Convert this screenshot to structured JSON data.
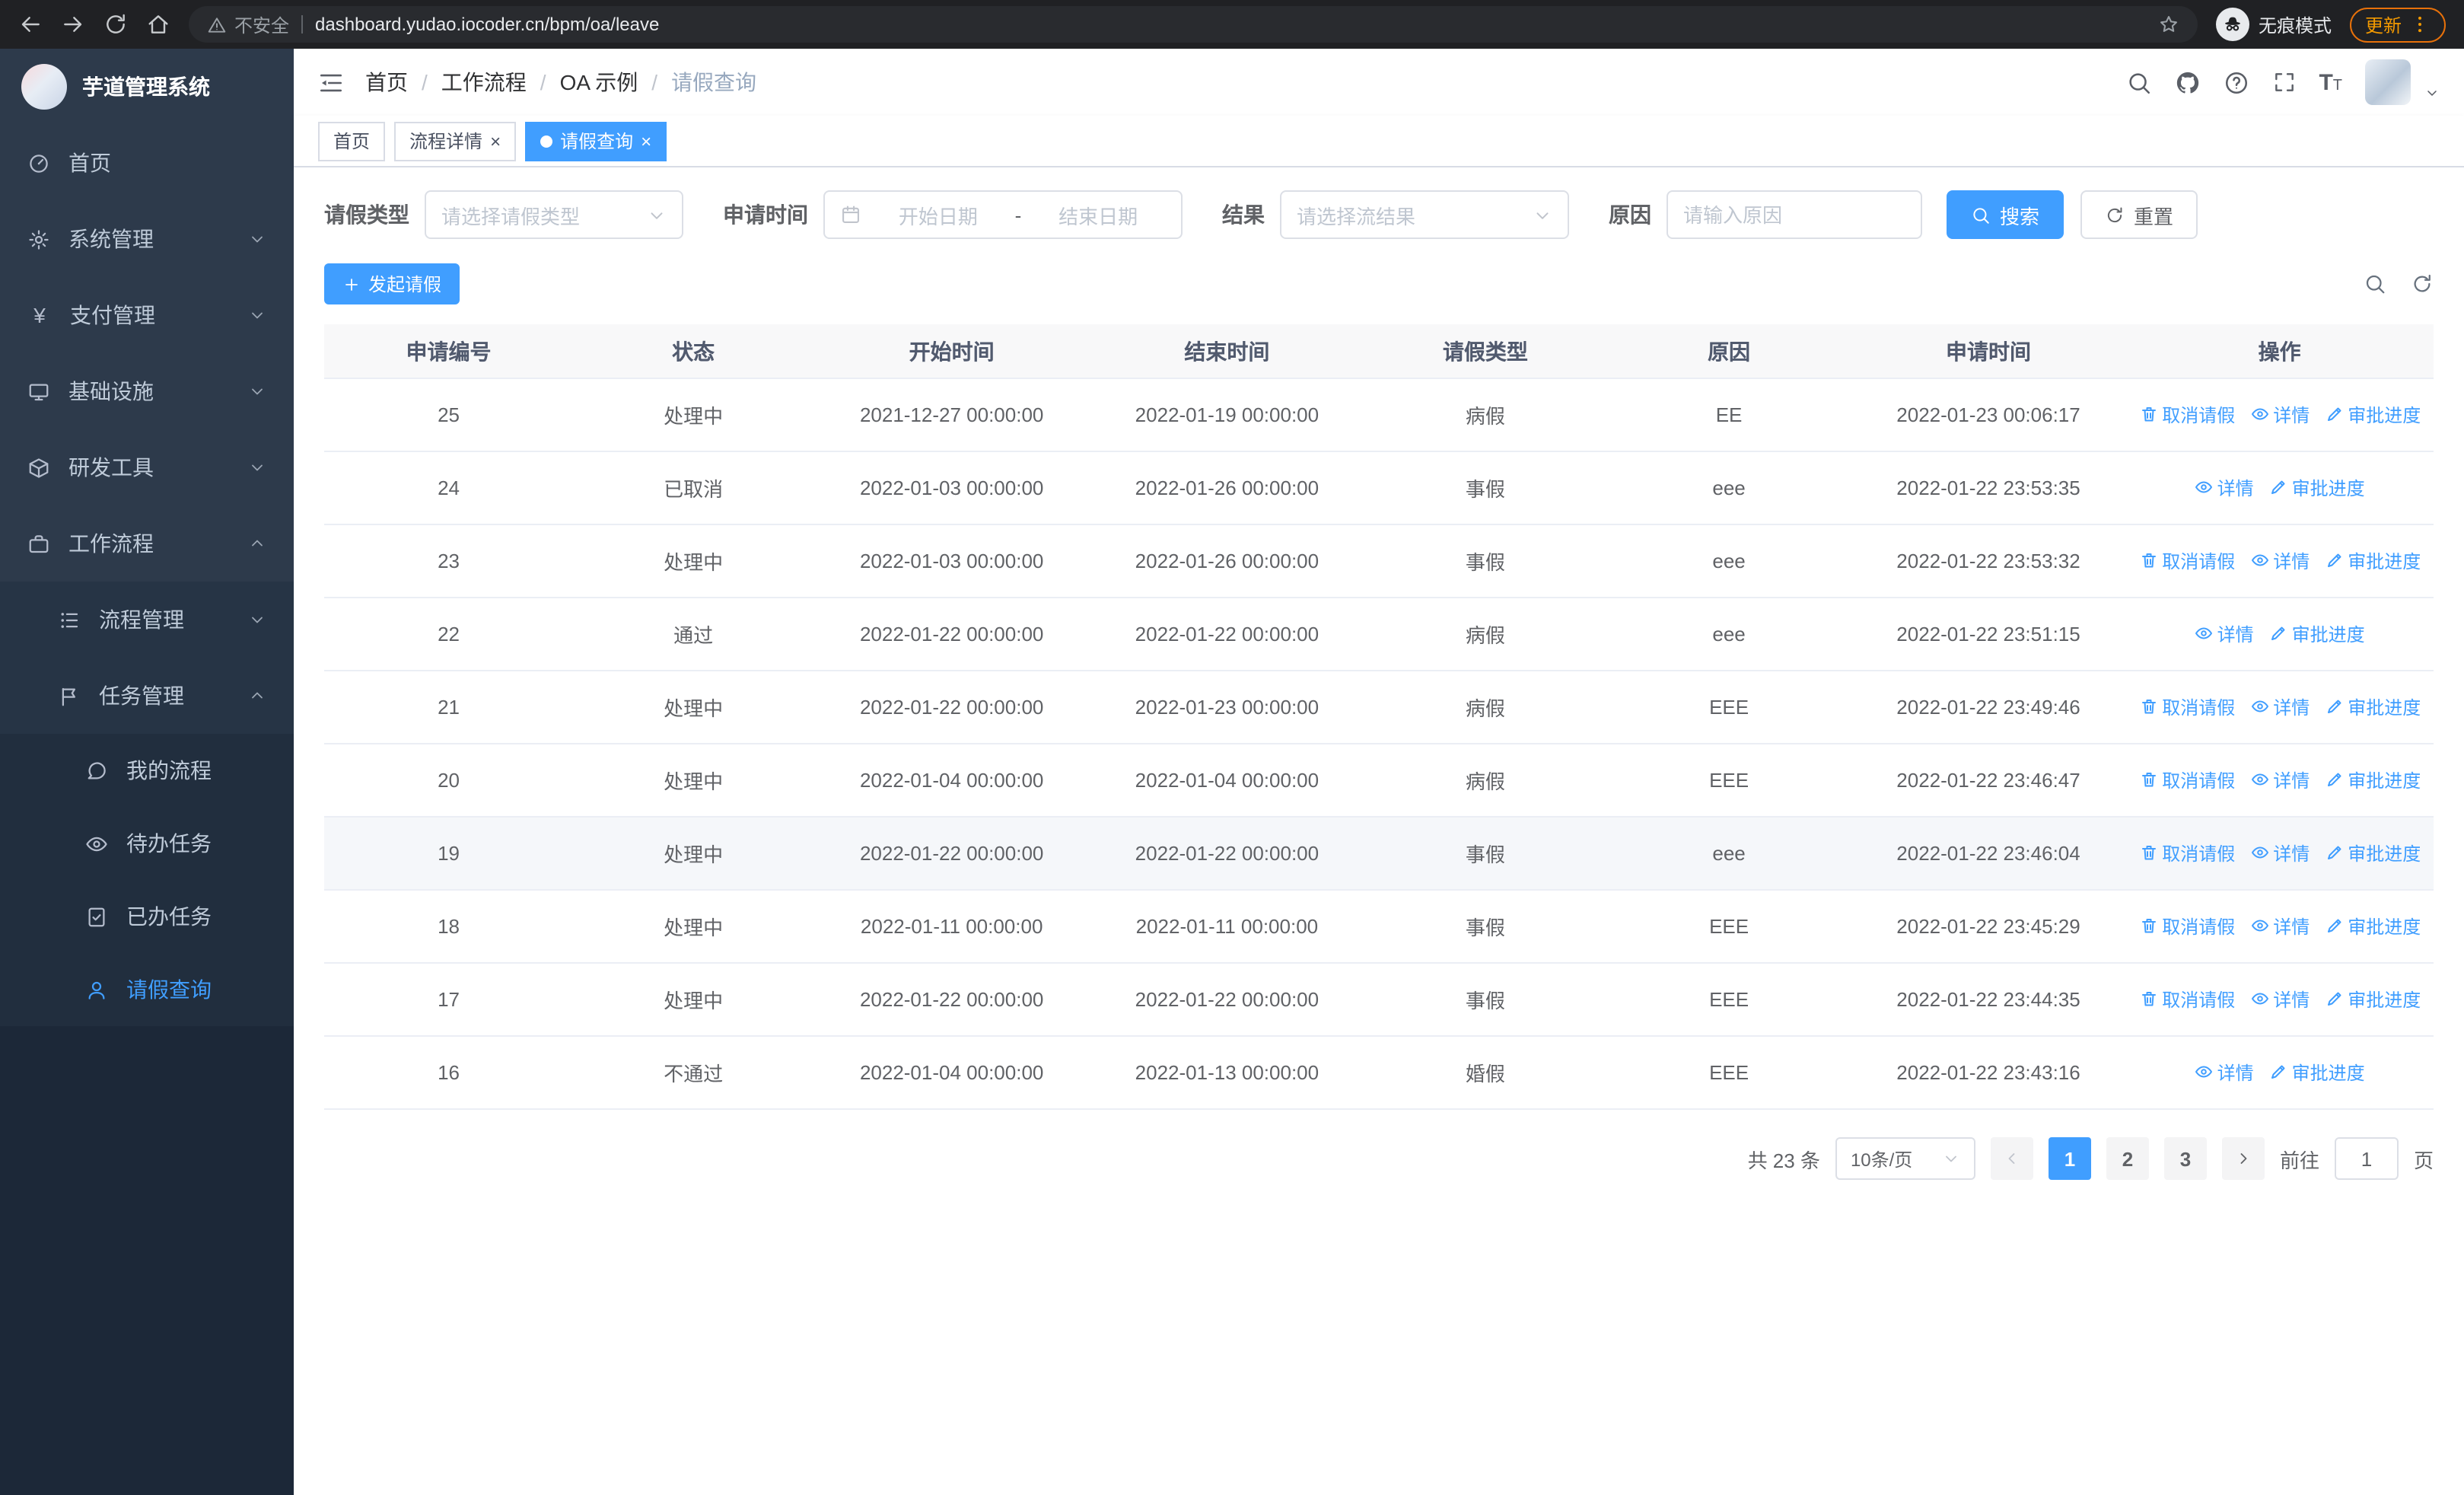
{
  "browser": {
    "security_label": "不安全",
    "url": "dashboard.yudao.iocoder.cn/bpm/oa/leave",
    "incognito_label": "无痕模式",
    "update_label": "更新"
  },
  "sidebar": {
    "app_title": "芋道管理系统",
    "items": [
      {
        "label": "首页"
      },
      {
        "label": "系统管理"
      },
      {
        "label": "支付管理"
      },
      {
        "label": "基础设施"
      },
      {
        "label": "研发工具"
      },
      {
        "label": "工作流程"
      }
    ],
    "workflow_children": [
      {
        "label": "流程管理"
      },
      {
        "label": "任务管理"
      }
    ],
    "task_children": [
      {
        "label": "我的流程"
      },
      {
        "label": "待办任务"
      },
      {
        "label": "已办任务"
      },
      {
        "label": "请假查询"
      }
    ]
  },
  "navbar": {
    "breadcrumb": [
      "首页",
      "工作流程",
      "OA 示例",
      "请假查询"
    ],
    "separator": "/"
  },
  "tabs": [
    {
      "label": "首页"
    },
    {
      "label": "流程详情"
    },
    {
      "label": "请假查询"
    }
  ],
  "filters": {
    "type_label": "请假类型",
    "type_placeholder": "请选择请假类型",
    "time_label": "申请时间",
    "start_placeholder": "开始日期",
    "range_separator": "-",
    "end_placeholder": "结束日期",
    "result_label": "结果",
    "result_placeholder": "请选择流结果",
    "reason_label": "原因",
    "reason_placeholder": "请输入原因",
    "search_label": "搜索",
    "reset_label": "重置"
  },
  "toolbar": {
    "create_label": "发起请假"
  },
  "table": {
    "headers": [
      "申请编号",
      "状态",
      "开始时间",
      "结束时间",
      "请假类型",
      "原因",
      "申请时间",
      "操作"
    ],
    "actions": {
      "cancel": "取消请假",
      "detail": "详情",
      "progress": "审批进度"
    },
    "rows": [
      {
        "id": "25",
        "status": "处理中",
        "start": "2021-12-27 00:00:00",
        "end": "2022-01-19 00:00:00",
        "type": "病假",
        "reason": "EE",
        "applied": "2022-01-23 00:06:17"
      },
      {
        "id": "24",
        "status": "已取消",
        "start": "2022-01-03 00:00:00",
        "end": "2022-01-26 00:00:00",
        "type": "事假",
        "reason": "eee",
        "applied": "2022-01-22 23:53:35"
      },
      {
        "id": "23",
        "status": "处理中",
        "start": "2022-01-03 00:00:00",
        "end": "2022-01-26 00:00:00",
        "type": "事假",
        "reason": "eee",
        "applied": "2022-01-22 23:53:32"
      },
      {
        "id": "22",
        "status": "通过",
        "start": "2022-01-22 00:00:00",
        "end": "2022-01-22 00:00:00",
        "type": "病假",
        "reason": "eee",
        "applied": "2022-01-22 23:51:15"
      },
      {
        "id": "21",
        "status": "处理中",
        "start": "2022-01-22 00:00:00",
        "end": "2022-01-23 00:00:00",
        "type": "病假",
        "reason": "EEE",
        "applied": "2022-01-22 23:49:46"
      },
      {
        "id": "20",
        "status": "处理中",
        "start": "2022-01-04 00:00:00",
        "end": "2022-01-04 00:00:00",
        "type": "病假",
        "reason": "EEE",
        "applied": "2022-01-22 23:46:47"
      },
      {
        "id": "19",
        "status": "处理中",
        "start": "2022-01-22 00:00:00",
        "end": "2022-01-22 00:00:00",
        "type": "事假",
        "reason": "eee",
        "applied": "2022-01-22 23:46:04"
      },
      {
        "id": "18",
        "status": "处理中",
        "start": "2022-01-11 00:00:00",
        "end": "2022-01-11 00:00:00",
        "type": "事假",
        "reason": "EEE",
        "applied": "2022-01-22 23:45:29"
      },
      {
        "id": "17",
        "status": "处理中",
        "start": "2022-01-22 00:00:00",
        "end": "2022-01-22 00:00:00",
        "type": "事假",
        "reason": "EEE",
        "applied": "2022-01-22 23:44:35"
      },
      {
        "id": "16",
        "status": "不通过",
        "start": "2022-01-04 00:00:00",
        "end": "2022-01-13 00:00:00",
        "type": "婚假",
        "reason": "EEE",
        "applied": "2022-01-22 23:43:16"
      }
    ]
  },
  "pagination": {
    "total": "共 23 条",
    "page_size": "10条/页",
    "pages": [
      "1",
      "2",
      "3"
    ],
    "active_page": "1",
    "goto_label": "前往",
    "goto_value": "1",
    "unit_label": "页"
  },
  "icons": {
    "yen_glyph": "¥",
    "text_size_glyph": "T",
    "close_glyph": "×"
  }
}
